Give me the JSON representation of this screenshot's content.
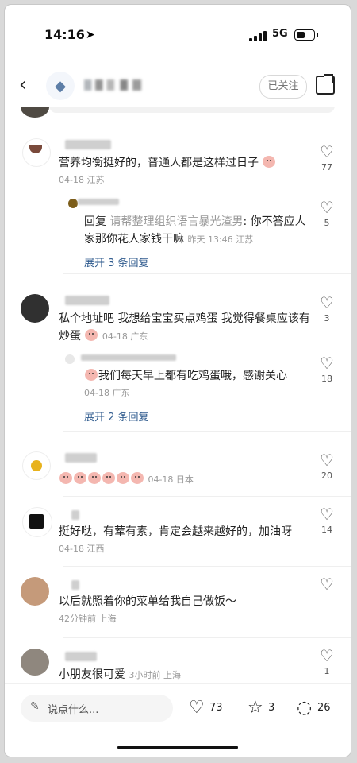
{
  "status": {
    "time": "14:16",
    "network": "5G"
  },
  "header": {
    "follow_label": "已关注"
  },
  "comments": [
    {
      "text": "营养均衡挺好的，普通人都是这样过日子",
      "meta": "04-18 江苏",
      "likes": "77"
    },
    {
      "reply_prefix": "回复",
      "reply_target": "请帮整理组织语言暴光渣男",
      "text": ": 你不答应人家那你花人家钱干嘛",
      "meta": "昨天 13:46 江苏",
      "likes": "5",
      "expand": "展开 3 条回复"
    },
    {
      "text": "私个地址吧 我想给宝宝买点鸡蛋 我觉得餐桌应该有炒蛋",
      "meta": "04-18 广东",
      "likes": "3"
    },
    {
      "text": "我们每天早上都有吃鸡蛋哦，感谢关心",
      "meta": "04-18 广东",
      "likes": "18",
      "expand": "展开 2 条回复"
    },
    {
      "meta": "04-18 日本",
      "likes": "20"
    },
    {
      "text": "挺好哒，有荤有素，肯定会越来越好的，加油呀",
      "meta": "04-18 江西",
      "likes": "14"
    },
    {
      "text": "以后就照着你的菜单给我自己做饭～",
      "meta": "42分钟前 上海",
      "likes": ""
    },
    {
      "text": "小朋友很可爱",
      "meta": "3小时前 上海",
      "likes": "1"
    }
  ],
  "bottom": {
    "placeholder": "说点什么...",
    "likes": "73",
    "stars": "3",
    "comments": "26"
  },
  "colors": {
    "link": "#2f5b8e",
    "muted": "#9a9a9a"
  }
}
